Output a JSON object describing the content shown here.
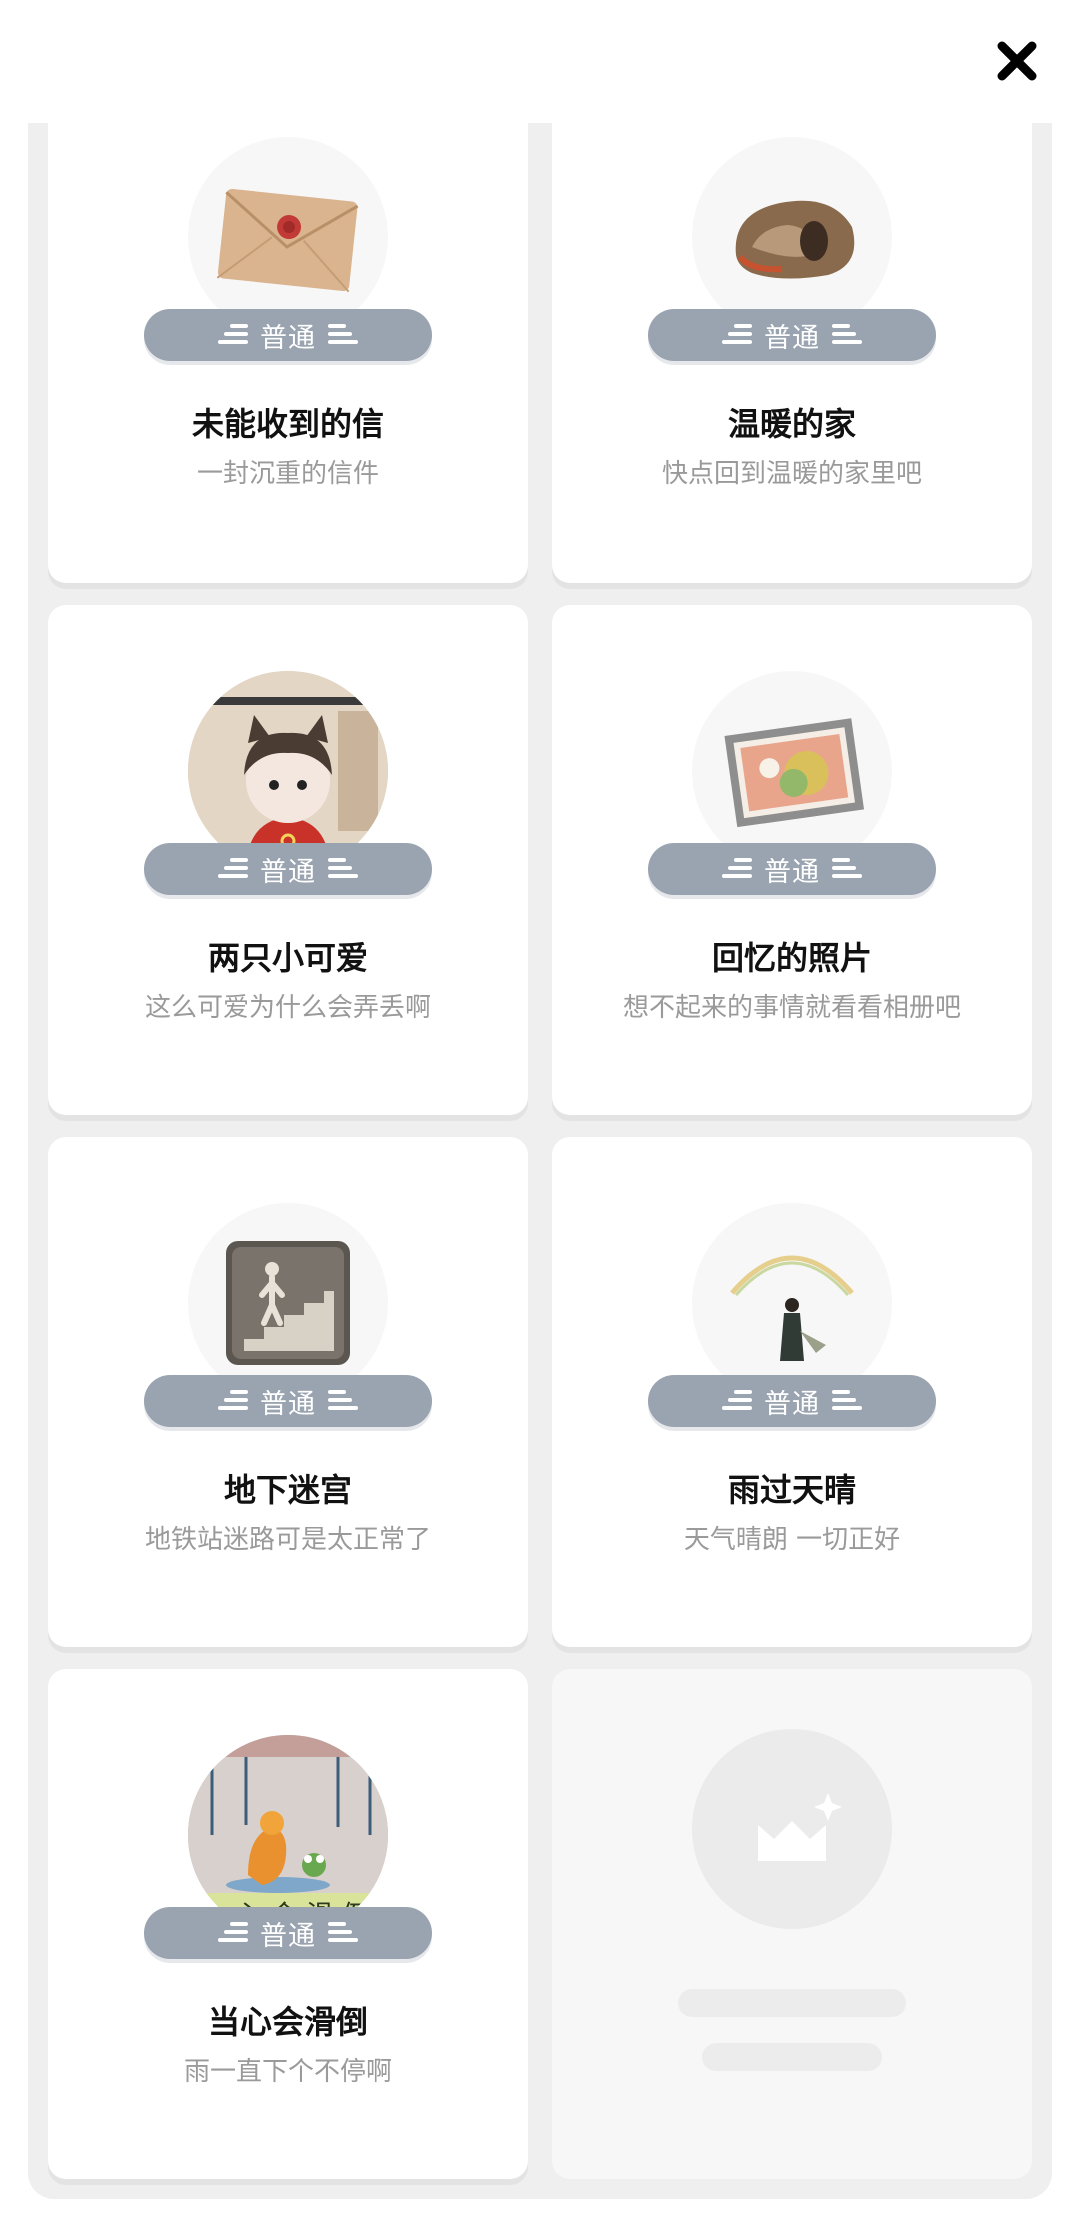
{
  "header": {
    "close_icon": "close-icon"
  },
  "rarity_label": "普通",
  "cards": [
    {
      "title": "未能收到的信",
      "desc": "一封沉重的信件",
      "rarity": "普通",
      "icon": "envelope-icon"
    },
    {
      "title": "温暖的家",
      "desc": "快点回到温暖的家里吧",
      "rarity": "普通",
      "icon": "home-rock-icon"
    },
    {
      "title": "两只小可爱",
      "desc": "这么可爱为什么会弄丢啊",
      "rarity": "普通",
      "icon": "cat-character-icon"
    },
    {
      "title": "回忆的照片",
      "desc": "想不起来的事情就看看相册吧",
      "rarity": "普通",
      "icon": "photo-frame-icon"
    },
    {
      "title": "地下迷宫",
      "desc": "地铁站迷路可是太正常了",
      "rarity": "普通",
      "icon": "stairs-icon"
    },
    {
      "title": "雨过天晴",
      "desc": "天气晴朗 一切正好",
      "rarity": "普通",
      "icon": "rainbow-icon"
    },
    {
      "title": "当心会滑倒",
      "desc": "雨一直下个不停啊",
      "rarity": "普通",
      "icon": "slippery-rain-icon",
      "badge_text": "小心会滑倒"
    }
  ],
  "locked_card": {
    "icon": "locked-image-icon"
  },
  "colors": {
    "rarity_bg": "#9aa4b0",
    "panel_bg": "#efefef",
    "title": "#111111",
    "desc": "#9a9a9a"
  }
}
